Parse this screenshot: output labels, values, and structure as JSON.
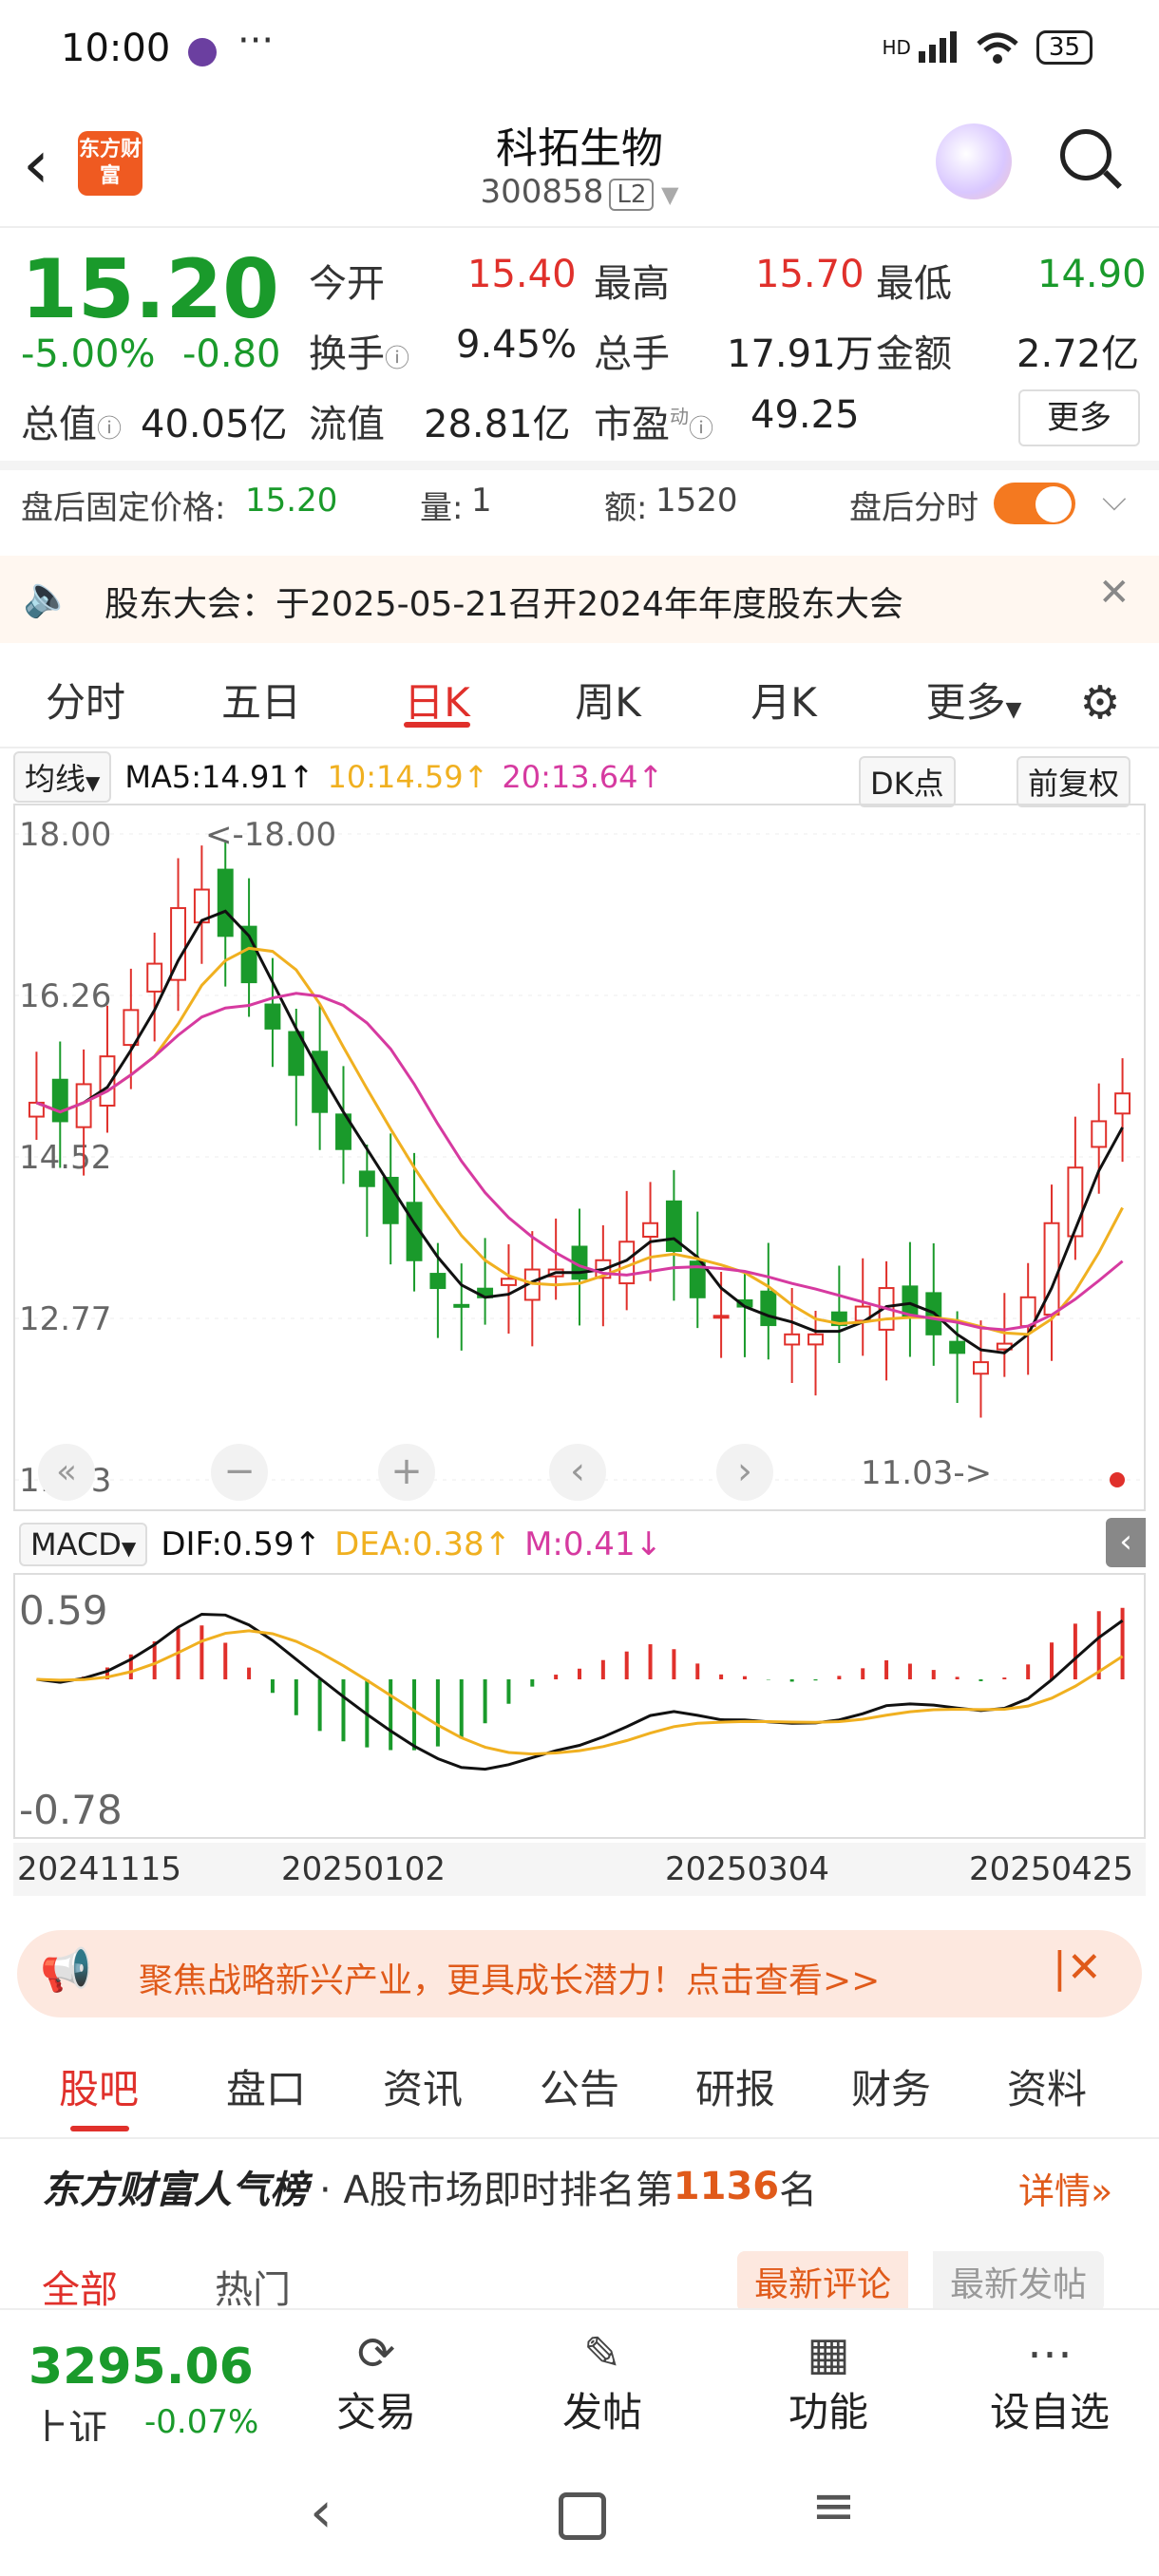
{
  "status": {
    "time": "10:00",
    "dots": "···",
    "network": "HD",
    "battery": "35"
  },
  "header": {
    "logo": "东方财富",
    "title": "科拓生物",
    "code": "300858",
    "level": "L2"
  },
  "quote": {
    "price": "15.20",
    "change_pct": "-5.00%",
    "change": "-0.80",
    "open_label": "今开",
    "open": "15.40",
    "high_label": "最高",
    "high": "15.70",
    "low_label": "最低",
    "low": "14.90",
    "turnover_label": "换手",
    "turnover": "9.45%",
    "volume_label": "总手",
    "volume": "17.91万",
    "amount_label": "金额",
    "amount": "2.72亿",
    "mcap_label": "总值",
    "mcap": "40.05亿",
    "float_label": "流值",
    "float": "28.81亿",
    "pe_label": "市盈",
    "pe_sup": "动",
    "pe": "49.25",
    "more_button": "更多"
  },
  "after_hours": {
    "price_label": "盘后固定价格:",
    "price": "15.20",
    "qty_label": "量:",
    "qty": "1",
    "amt_label": "额:",
    "amt": "1520",
    "toggle_label": "盘后分时"
  },
  "notice": {
    "text": "股东大会：于2025-05-21召开2024年年度股东大会"
  },
  "tabs": [
    "分时",
    "五日",
    "日K",
    "周K",
    "月K",
    "更多"
  ],
  "ma": {
    "selector": "均线",
    "ma5": "MA5:14.91↑",
    "ma10": "10:14.59↑",
    "ma20": "20:13.64↑",
    "dk": "DK点",
    "adj": "前复权"
  },
  "macd": {
    "selector": "MACD",
    "dif": "DIF:0.59↑",
    "dea": "DEA:0.38↑",
    "m": "M:0.41↓"
  },
  "chart_data": {
    "type": "candlestick",
    "y_ticks": [
      "18.00",
      "16.26",
      "14.52",
      "12.77",
      "11.03"
    ],
    "high_label": "<-18.00",
    "low_label": "11.03->",
    "ylim": [
      11.03,
      18.0
    ],
    "close_approx": [
      15.1,
      14.9,
      15.3,
      15.6,
      16.1,
      16.6,
      17.2,
      17.4,
      16.9,
      16.4,
      15.9,
      15.4,
      15.0,
      14.6,
      14.2,
      13.8,
      13.4,
      13.1,
      12.9,
      13.0,
      13.2,
      13.3,
      13.3,
      13.2,
      13.4,
      13.6,
      13.8,
      13.5,
      13.0,
      12.8,
      12.9,
      12.7,
      12.6,
      12.6,
      12.7,
      12.9,
      13.1,
      12.8,
      12.6,
      12.4,
      12.3,
      12.5,
      13.0,
      13.8,
      14.4,
      14.9,
      15.2
    ],
    "macd": {
      "y_ticks": [
        "0.59",
        "-0.78"
      ]
    },
    "x_ticks": [
      "20241115",
      "20250102",
      "20250304",
      "20250425"
    ],
    "colors": {
      "up": "#e0302b",
      "down": "#1a9a2b",
      "ma5": "#111111",
      "ma10": "#f0b020",
      "ma20": "#d63aa0"
    }
  },
  "banner": {
    "text": "聚焦战略新兴产业，更具成长潜力！点击查看>>"
  },
  "subtabs": [
    "股吧",
    "盘口",
    "资讯",
    "公告",
    "研报",
    "财务",
    "资料"
  ],
  "rank": {
    "brand": "东方财富人气榜",
    "text_pre": "· A股市场即时排名第",
    "rank": "1136",
    "text_post": "名",
    "details": "详情"
  },
  "filter": {
    "all": "全部",
    "hot": "热门",
    "latest_comment": "最新评论",
    "latest_post": "最新发帖"
  },
  "bottomnav": {
    "index_value": "3295.06",
    "index_name": "上证",
    "index_change": "-0.07%",
    "items": [
      "交易",
      "发帖",
      "功能",
      "设自选"
    ]
  }
}
